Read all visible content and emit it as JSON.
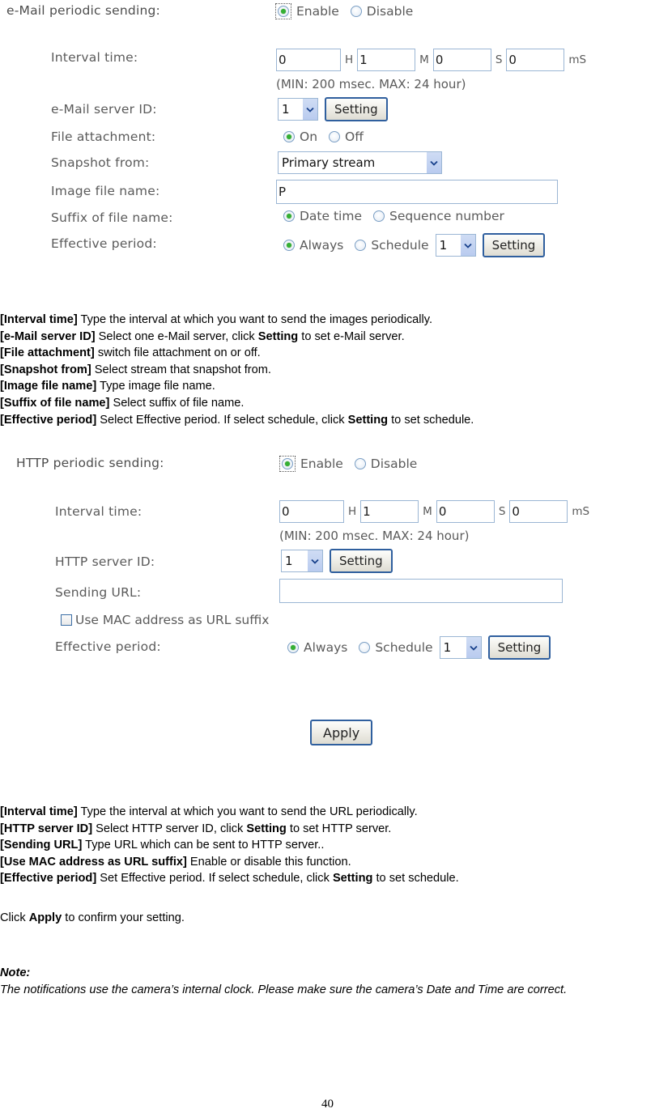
{
  "page": {
    "number": "40"
  },
  "email_section": {
    "title_label": "e-Mail periodic sending:",
    "enable_label": "Enable",
    "disable_label": "Disable",
    "interval_label": "Interval time:",
    "interval": {
      "h": "0",
      "m": "1",
      "s": "0",
      "ms": "0"
    },
    "unit_h": "H",
    "unit_m": "M",
    "unit_s": "S",
    "unit_ms": "mS",
    "range_hint": "(MIN: 200 msec. MAX: 24 hour)",
    "server_id_label": "e-Mail server ID:",
    "server_id_value": "1",
    "server_setting_button": "Setting",
    "file_attachment_label": "File attachment:",
    "on_label": "On",
    "off_label": "Off",
    "snapshot_from_label": "Snapshot from:",
    "snapshot_from_value": "Primary stream",
    "image_file_name_label": "Image file name:",
    "image_file_name_value": "P",
    "suffix_label": "Suffix of file name:",
    "suffix_date_time_label": "Date time",
    "suffix_sequence_label": "Sequence number",
    "effective_period_label": "Effective period:",
    "always_label": "Always",
    "schedule_label": "Schedule",
    "schedule_value": "1",
    "schedule_setting_button": "Setting"
  },
  "email_docs": [
    {
      "term": "[Interval time]",
      "text": " Type the interval at which you want to send the images periodically."
    },
    {
      "term": "[e-Mail server ID]",
      "text": " Select one e-Mail server, click ",
      "bold": "Setting",
      "text2": " to set e-Mail server."
    },
    {
      "term": "[File attachment]",
      "text": " switch file attachment on or off."
    },
    {
      "term": "[Snapshot from]",
      "text": " Select stream that snapshot from."
    },
    {
      "term": "[Image file name]",
      "text": " Type image file name."
    },
    {
      "term": "[Suffix of file name]",
      "text": " Select suffix of file name."
    },
    {
      "term": "[Effective period]",
      "text": " Select Effective period. If select schedule, click ",
      "bold": "Setting",
      "text2": " to set schedule."
    }
  ],
  "http_section": {
    "title_label": "HTTP periodic sending:",
    "enable_label": "Enable",
    "disable_label": "Disable",
    "interval_label": "Interval time:",
    "interval": {
      "h": "0",
      "m": "1",
      "s": "0",
      "ms": "0"
    },
    "unit_h": "H",
    "unit_m": "M",
    "unit_s": "S",
    "unit_ms": "mS",
    "range_hint": "(MIN: 200 msec. MAX: 24 hour)",
    "server_id_label": "HTTP server ID:",
    "server_id_value": "1",
    "server_setting_button": "Setting",
    "sending_url_label": "Sending URL:",
    "sending_url_value": "",
    "use_mac_label": "Use MAC address as URL suffix",
    "effective_period_label": "Effective period:",
    "always_label": "Always",
    "schedule_label": "Schedule",
    "schedule_value": "1",
    "schedule_setting_button": "Setting",
    "apply_button": "Apply"
  },
  "http_docs": [
    {
      "term": "[Interval time]",
      "text": " Type the interval at which you want to send the URL periodically."
    },
    {
      "term": "[HTTP server ID]",
      "text": " Select HTTP server ID, click ",
      "bold": "Setting",
      "text2": " to set HTTP server."
    },
    {
      "term": "[Sending URL]",
      "text": " Type URL which can be sent to HTTP server.."
    },
    {
      "term": "[Use MAC address as URL suffix]",
      "text": " Enable or disable this function."
    },
    {
      "term": "[Effective period]",
      "text": " Set Effective period. If select schedule, click ",
      "bold": "Setting",
      "text2": " to set schedule."
    }
  ],
  "apply_note": {
    "prefix": "Click ",
    "bold": "Apply",
    "suffix": " to confirm your setting."
  },
  "note": {
    "title": "Note:",
    "body": "The notifications use the camera’s internal clock. Please make sure the camera’s Date and Time are correct."
  },
  "colors": {
    "label_gray": "#5a5a5a",
    "input_border": "#9bb6d4",
    "button_border": "#2f5f9e",
    "radio_dot_green": "#35b034",
    "select_arrow_bg": "#c3d3f1"
  }
}
